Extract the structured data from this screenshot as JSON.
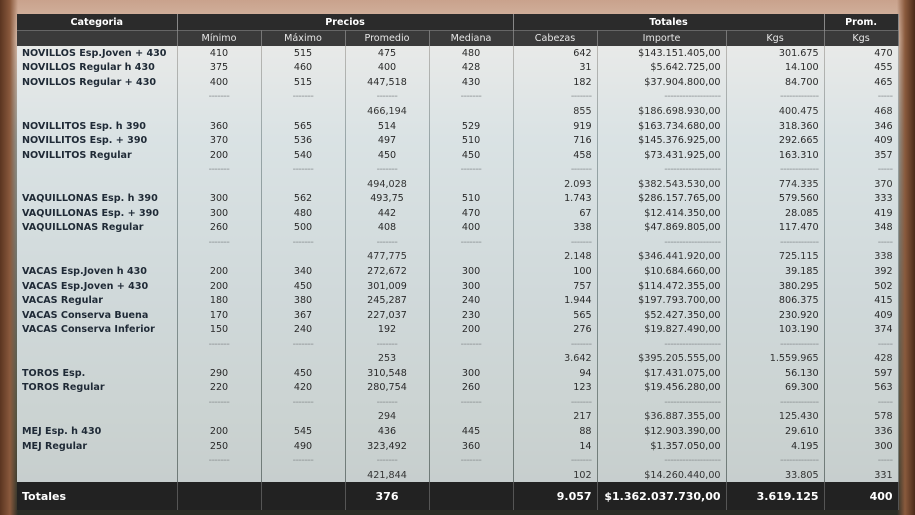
{
  "headers": {
    "categoria": "Categoria",
    "precios": "Precios",
    "totales": "Totales",
    "prom": "Prom.",
    "minimo": "Mínimo",
    "maximo": "Máximo",
    "promedio": "Promedio",
    "mediana": "Mediana",
    "cabezas": "Cabezas",
    "importe": "Importe",
    "kgs": "Kgs",
    "kgs_prom": "Kgs"
  },
  "rows": [
    {
      "type": "data",
      "name": "NOVILLOS Esp.Joven + 430",
      "min": "410",
      "max": "515",
      "prom": "475",
      "med": "480",
      "cab": "642",
      "imp": "$143.151.405,00",
      "kgs": "301.675",
      "pk": "470"
    },
    {
      "type": "data",
      "name": "NOVILLOS Regular h 430",
      "min": "375",
      "max": "460",
      "prom": "400",
      "med": "428",
      "cab": "31",
      "imp": "$5.642.725,00",
      "kgs": "14.100",
      "pk": "455"
    },
    {
      "type": "data",
      "name": "NOVILLOS Regular + 430",
      "min": "400",
      "max": "515",
      "prom": "447,518",
      "med": "430",
      "cab": "182",
      "imp": "$37.904.800,00",
      "kgs": "84.700",
      "pk": "465"
    },
    {
      "type": "dash",
      "min": "-------",
      "max": "-------",
      "prom": "-------",
      "med": "-------",
      "cab": "-------",
      "imp": "-------------------",
      "kgs": "-------------",
      "pk": "-----"
    },
    {
      "type": "sum",
      "prom": "466,194",
      "cab": "855",
      "imp": "$186.698.930,00",
      "kgs": "400.475",
      "pk": "468"
    },
    {
      "type": "data",
      "name": "NOVILLITOS Esp. h 390",
      "min": "360",
      "max": "565",
      "prom": "514",
      "med": "529",
      "cab": "919",
      "imp": "$163.734.680,00",
      "kgs": "318.360",
      "pk": "346"
    },
    {
      "type": "data",
      "name": "NOVILLITOS Esp. + 390",
      "min": "370",
      "max": "536",
      "prom": "497",
      "med": "510",
      "cab": "716",
      "imp": "$145.376.925,00",
      "kgs": "292.665",
      "pk": "409"
    },
    {
      "type": "data",
      "name": "NOVILLITOS Regular",
      "min": "200",
      "max": "540",
      "prom": "450",
      "med": "450",
      "cab": "458",
      "imp": "$73.431.925,00",
      "kgs": "163.310",
      "pk": "357"
    },
    {
      "type": "dash",
      "min": "-------",
      "max": "-------",
      "prom": "-------",
      "med": "-------",
      "cab": "-------",
      "imp": "-------------------",
      "kgs": "-------------",
      "pk": "-----"
    },
    {
      "type": "sum",
      "prom": "494,028",
      "cab": "2.093",
      "imp": "$382.543.530,00",
      "kgs": "774.335",
      "pk": "370"
    },
    {
      "type": "data",
      "name": "VAQUILLONAS Esp. h 390",
      "min": "300",
      "max": "562",
      "prom": "493,75",
      "med": "510",
      "cab": "1.743",
      "imp": "$286.157.765,00",
      "kgs": "579.560",
      "pk": "333"
    },
    {
      "type": "data",
      "name": "VAQUILLONAS Esp. + 390",
      "min": "300",
      "max": "480",
      "prom": "442",
      "med": "470",
      "cab": "67",
      "imp": "$12.414.350,00",
      "kgs": "28.085",
      "pk": "419"
    },
    {
      "type": "data",
      "name": "VAQUILLONAS Regular",
      "min": "260",
      "max": "500",
      "prom": "408",
      "med": "400",
      "cab": "338",
      "imp": "$47.869.805,00",
      "kgs": "117.470",
      "pk": "348"
    },
    {
      "type": "dash",
      "min": "-------",
      "max": "-------",
      "prom": "-------",
      "med": "-------",
      "cab": "-------",
      "imp": "-------------------",
      "kgs": "-------------",
      "pk": "-----"
    },
    {
      "type": "sum",
      "prom": "477,775",
      "cab": "2.148",
      "imp": "$346.441.920,00",
      "kgs": "725.115",
      "pk": "338"
    },
    {
      "type": "data",
      "name": "VACAS Esp.Joven h 430",
      "min": "200",
      "max": "340",
      "prom": "272,672",
      "med": "300",
      "cab": "100",
      "imp": "$10.684.660,00",
      "kgs": "39.185",
      "pk": "392"
    },
    {
      "type": "data",
      "name": "VACAS Esp.Joven + 430",
      "min": "200",
      "max": "450",
      "prom": "301,009",
      "med": "300",
      "cab": "757",
      "imp": "$114.472.355,00",
      "kgs": "380.295",
      "pk": "502"
    },
    {
      "type": "data",
      "name": "VACAS Regular",
      "min": "180",
      "max": "380",
      "prom": "245,287",
      "med": "240",
      "cab": "1.944",
      "imp": "$197.793.700,00",
      "kgs": "806.375",
      "pk": "415"
    },
    {
      "type": "data",
      "name": "VACAS Conserva Buena",
      "min": "170",
      "max": "367",
      "prom": "227,037",
      "med": "230",
      "cab": "565",
      "imp": "$52.427.350,00",
      "kgs": "230.920",
      "pk": "409"
    },
    {
      "type": "data",
      "name": "VACAS Conserva Inferior",
      "min": "150",
      "max": "240",
      "prom": "192",
      "med": "200",
      "cab": "276",
      "imp": "$19.827.490,00",
      "kgs": "103.190",
      "pk": "374"
    },
    {
      "type": "dash",
      "min": "-------",
      "max": "-------",
      "prom": "-------",
      "med": "-------",
      "cab": "-------",
      "imp": "-------------------",
      "kgs": "-------------",
      "pk": "-----"
    },
    {
      "type": "sum",
      "prom": "253",
      "cab": "3.642",
      "imp": "$395.205.555,00",
      "kgs": "1.559.965",
      "pk": "428"
    },
    {
      "type": "data",
      "name": "TOROS Esp.",
      "min": "290",
      "max": "450",
      "prom": "310,548",
      "med": "300",
      "cab": "94",
      "imp": "$17.431.075,00",
      "kgs": "56.130",
      "pk": "597"
    },
    {
      "type": "data",
      "name": "TOROS Regular",
      "min": "220",
      "max": "420",
      "prom": "280,754",
      "med": "260",
      "cab": "123",
      "imp": "$19.456.280,00",
      "kgs": "69.300",
      "pk": "563"
    },
    {
      "type": "dash",
      "min": "-------",
      "max": "-------",
      "prom": "-------",
      "med": "-------",
      "cab": "-------",
      "imp": "-------------------",
      "kgs": "-------------",
      "pk": "-----"
    },
    {
      "type": "sum",
      "prom": "294",
      "cab": "217",
      "imp": "$36.887.355,00",
      "kgs": "125.430",
      "pk": "578"
    },
    {
      "type": "data",
      "name": "MEJ Esp. h 430",
      "min": "200",
      "max": "545",
      "prom": "436",
      "med": "445",
      "cab": "88",
      "imp": "$12.903.390,00",
      "kgs": "29.610",
      "pk": "336"
    },
    {
      "type": "data",
      "name": "MEJ Regular",
      "min": "250",
      "max": "490",
      "prom": "323,492",
      "med": "360",
      "cab": "14",
      "imp": "$1.357.050,00",
      "kgs": "4.195",
      "pk": "300"
    },
    {
      "type": "dash",
      "min": "-------",
      "max": "-------",
      "prom": "-------",
      "med": "-------",
      "cab": "-------",
      "imp": "-------------------",
      "kgs": "-------------",
      "pk": "-----"
    },
    {
      "type": "sum",
      "prom": "421,844",
      "cab": "102",
      "imp": "$14.260.440,00",
      "kgs": "33.805",
      "pk": "331"
    }
  ],
  "totals": {
    "label": "Totales",
    "prom": "376",
    "cab": "9.057",
    "imp": "$1.362.037.730,00",
    "kgs": "3.619.125",
    "pk": "400"
  }
}
